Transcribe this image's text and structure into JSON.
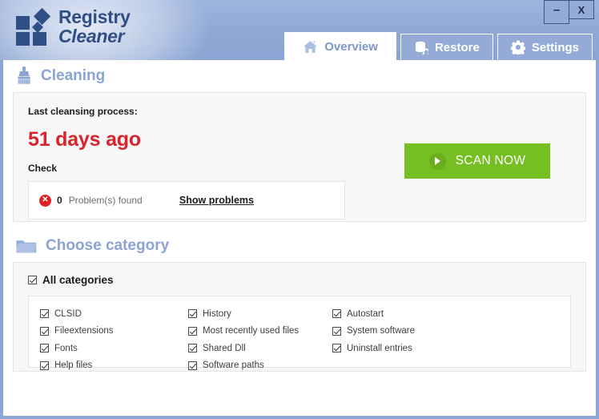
{
  "window": {
    "minimize_label": "–",
    "close_label": "X"
  },
  "brand": {
    "line1": "Registry",
    "line2": "Cleaner",
    "logo_icon": "squares-diamonds-logo"
  },
  "tabs": [
    {
      "label": "Overview",
      "icon": "home-icon",
      "active": true
    },
    {
      "label": "Restore",
      "icon": "database-restore-icon",
      "active": false
    },
    {
      "label": "Settings",
      "icon": "gear-icon",
      "active": false
    }
  ],
  "cleaning": {
    "heading": "Cleaning",
    "heading_icon": "brush-icon",
    "last_label": "Last cleansing process:",
    "days_ago": "51 days ago",
    "check_label": "Check",
    "error_icon_glyph": "✕",
    "problem_count": "0",
    "problem_text": "Problem(s) found",
    "show_problems_label": "Show problems",
    "scan_button_label": "SCAN NOW",
    "scan_button_icon": "play-icon",
    "scan_button_color": "#76bf22",
    "days_ago_color": "#d9232d"
  },
  "categories": {
    "heading": "Choose category",
    "heading_icon": "folder-icon",
    "all_label": "All categories",
    "all_checked": true,
    "columns": [
      [
        {
          "label": "CLSID",
          "checked": true
        },
        {
          "label": "Fileextensions",
          "checked": true
        },
        {
          "label": "Fonts",
          "checked": true
        },
        {
          "label": "Help files",
          "checked": true
        }
      ],
      [
        {
          "label": "History",
          "checked": true
        },
        {
          "label": "Most recently used files",
          "checked": true
        },
        {
          "label": "Shared Dll",
          "checked": true
        },
        {
          "label": "Software paths",
          "checked": true
        }
      ],
      [
        {
          "label": "Autostart",
          "checked": true
        },
        {
          "label": "System software",
          "checked": true
        },
        {
          "label": "Uninstall entries",
          "checked": true
        }
      ]
    ]
  },
  "theme": {
    "header_blue": "#8ea8d6",
    "accent_blue": "#8ba3d2",
    "brand_navy": "#2f4f84"
  }
}
